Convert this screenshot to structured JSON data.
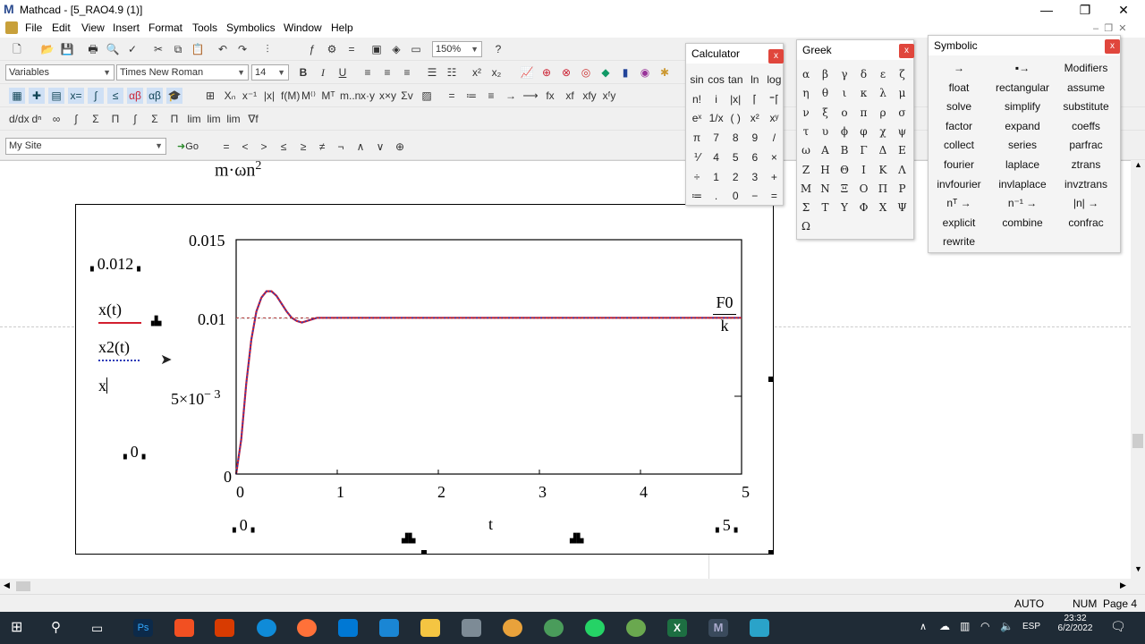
{
  "window": {
    "app_icon": "M",
    "title": "Mathcad - [5_RAO4.9 (1)]"
  },
  "menu": [
    "File",
    "Edit",
    "View",
    "Insert",
    "Format",
    "Tools",
    "Symbolics",
    "Window",
    "Help"
  ],
  "format_bar": {
    "style": "Variables",
    "font": "Times New Roman",
    "size": "14",
    "zoom": "150%"
  },
  "resource_bar": {
    "site": "My Site",
    "go": "Go"
  },
  "calculator": {
    "title": "Calculator",
    "keys": [
      [
        "sin",
        "cos",
        "tan",
        "ln",
        "log"
      ],
      [
        "n!",
        "i",
        "|x|",
        "⌈",
        "⁼⌈"
      ],
      [
        "eˣ",
        "1/x",
        "( )",
        "x²",
        "xʸ"
      ],
      [
        "π",
        "7",
        "8",
        "9",
        "/"
      ],
      [
        "⅟",
        "4",
        "5",
        "6",
        "×"
      ],
      [
        "÷",
        "1",
        "2",
        "3",
        "+"
      ],
      [
        "≔",
        ".",
        "0",
        "−",
        "="
      ]
    ]
  },
  "greek": {
    "title": "Greek",
    "rows": [
      [
        "α",
        "β",
        "γ",
        "δ",
        "ε",
        "ζ"
      ],
      [
        "η",
        "θ",
        "ι",
        "κ",
        "λ",
        "μ"
      ],
      [
        "ν",
        "ξ",
        "ο",
        "π",
        "ρ",
        "σ"
      ],
      [
        "τ",
        "υ",
        "ϕ",
        "φ",
        "χ",
        "ψ"
      ],
      [
        "ω",
        "Α",
        "Β",
        "Γ",
        "Δ",
        "Ε"
      ],
      [
        "Ζ",
        "Η",
        "Θ",
        "Ι",
        "Κ",
        "Λ"
      ],
      [
        "Μ",
        "Ν",
        "Ξ",
        "Ο",
        "Π",
        "Ρ"
      ],
      [
        "Σ",
        "Τ",
        "Υ",
        "Φ",
        "Χ",
        "Ψ"
      ],
      [
        "Ω"
      ]
    ]
  },
  "symbolic": {
    "title": "Symbolic",
    "rows": [
      [
        "→",
        "▪→",
        "Modifiers"
      ],
      [
        "float",
        "rectangular",
        "assume"
      ],
      [
        "solve",
        "simplify",
        "substitute"
      ],
      [
        "factor",
        "expand",
        "coeffs"
      ],
      [
        "collect",
        "series",
        "parfrac"
      ],
      [
        "fourier",
        "laplace",
        "ztrans"
      ],
      [
        "invfourier",
        "invlaplace",
        "invztrans"
      ],
      [
        "nᵀ →",
        "n⁻¹ →",
        "|n| →"
      ],
      [
        "explicit",
        "combine",
        "confrac"
      ],
      [
        "rewrite"
      ]
    ]
  },
  "worksheet": {
    "expr_top": "m·ωn",
    "expr_top_exp": "2"
  },
  "plot": {
    "y_top_label": "0.015",
    "y_mid_label": "0.01",
    "y_low_label": "5×10",
    "y_low_exp": "− 3",
    "y_zero": "0",
    "x_ticks": [
      "0",
      "1",
      "2",
      "3",
      "4",
      "5"
    ],
    "xlabel": "t",
    "y_limit_top": "0.012",
    "y_limit_bottom": "0",
    "x_limit_left": "0",
    "x_limit_right": "5",
    "legend": [
      "x(t)",
      "x2(t)",
      "x"
    ],
    "marker_num": "F0",
    "marker_den": "k"
  },
  "chart_data": {
    "type": "line",
    "xlabel": "t",
    "ylabel": "",
    "xlim": [
      0,
      5
    ],
    "ylim": [
      0,
      0.015
    ],
    "series": [
      {
        "name": "x(t)",
        "color": "#d21f2f",
        "x": [
          0,
          0.05,
          0.1,
          0.15,
          0.2,
          0.25,
          0.3,
          0.35,
          0.4,
          0.45,
          0.5,
          0.55,
          0.6,
          0.65,
          0.7,
          0.75,
          0.8,
          0.9,
          1,
          1.2,
          1.5,
          2,
          3,
          4,
          5
        ],
        "y": [
          0,
          0.0022,
          0.0058,
          0.0086,
          0.0104,
          0.0113,
          0.0117,
          0.0117,
          0.0114,
          0.0109,
          0.0104,
          0.01,
          0.0098,
          0.0097,
          0.0098,
          0.0099,
          0.01,
          0.01,
          0.01,
          0.01,
          0.01,
          0.01,
          0.01,
          0.01,
          0.01
        ]
      },
      {
        "name": "x2(t)",
        "color": "#2a3bb8",
        "x": [
          0,
          0.05,
          0.1,
          0.15,
          0.2,
          0.25,
          0.3,
          0.35,
          0.4,
          0.45,
          0.5,
          0.55,
          0.6,
          0.65,
          0.7,
          0.75,
          0.8,
          0.9,
          1,
          1.2,
          1.5,
          2,
          3,
          4,
          5
        ],
        "y": [
          0,
          0.0022,
          0.0058,
          0.0086,
          0.0104,
          0.0113,
          0.0117,
          0.0117,
          0.0114,
          0.0109,
          0.0104,
          0.01,
          0.0098,
          0.0097,
          0.0098,
          0.0099,
          0.01,
          0.01,
          0.01,
          0.01,
          0.01,
          0.01,
          0.01,
          0.01,
          0.01
        ]
      },
      {
        "name": "x",
        "color": "#b03030",
        "x": [
          0,
          5
        ],
        "y": [
          0.01,
          0.01
        ]
      }
    ]
  },
  "status": {
    "mode": "AUTO",
    "num": "NUM",
    "page": "Page 4"
  },
  "taskbar": {
    "lang": "ESP",
    "time": "23:32",
    "date": "6/2/2022"
  }
}
